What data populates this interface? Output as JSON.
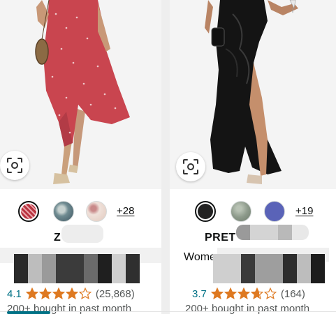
{
  "products": [
    {
      "brand": "Z",
      "title": "",
      "rating": "4.1",
      "stars": 4.1,
      "review_count": "(25,868)",
      "bought": "200+ bought in past month",
      "more_colors": "+28",
      "swatches": [
        {
          "color": "#b8323e",
          "selected": true
        },
        {
          "color": "#7a8f92",
          "selected": false
        },
        {
          "color": "#e7d2c7",
          "selected": false
        }
      ],
      "image": {
        "dress_color": "#c9454f",
        "icon": "woman-in-red-wrap-dress"
      }
    },
    {
      "brand": "PRET",
      "title": "Wome",
      "rating": "3.7",
      "stars": 3.7,
      "review_count": "(164)",
      "bought": "200+ bought in past month",
      "more_colors": "+19",
      "swatches": [
        {
          "color": "#222222",
          "selected": true
        },
        {
          "color": "#8e9b8c",
          "selected": false
        },
        {
          "color": "#5a63b8",
          "selected": false
        }
      ],
      "image": {
        "dress_color": "#111111",
        "icon": "woman-in-black-satin-dress"
      }
    }
  ],
  "colors": {
    "star": "#de7921",
    "link": "#007185",
    "muted": "#565959"
  },
  "icons": {
    "lens": "camera-search-icon",
    "star": "star-icon"
  }
}
